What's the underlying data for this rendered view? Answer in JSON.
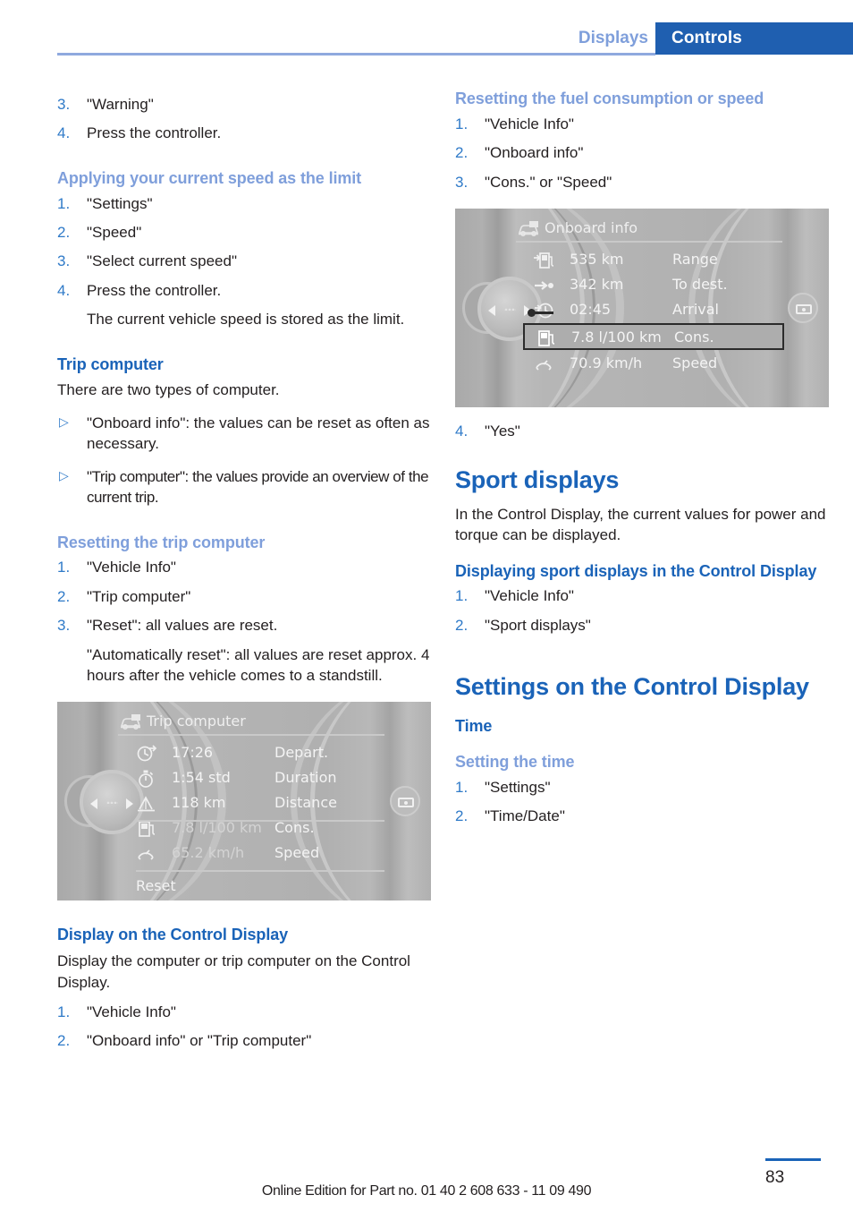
{
  "header": {
    "tab_inactive": "Displays",
    "tab_active": "Controls"
  },
  "left_column": {
    "steps_top": [
      {
        "num": "3.",
        "text": "\"Warning\""
      },
      {
        "num": "4.",
        "text": "Press the controller."
      }
    ],
    "heading_apply_speed": "Applying your current speed as the limit",
    "steps_apply_speed": [
      {
        "num": "1.",
        "text": "\"Settings\""
      },
      {
        "num": "2.",
        "text": "\"Speed\""
      },
      {
        "num": "3.",
        "text": "\"Select current speed\""
      },
      {
        "num": "4.",
        "text": "Press the controller."
      }
    ],
    "apply_speed_note": "The current vehicle speed is stored as the limit.",
    "heading_trip_computer": "Trip computer",
    "trip_intro": "There are two types of computer.",
    "trip_bullets": [
      "\"Onboard info\": the values can be reset as often as necessary.",
      "\"Trip computer\": the values provide an overview of the current trip."
    ],
    "heading_resetting": "Resetting the trip computer",
    "steps_resetting": [
      {
        "num": "1.",
        "text": "\"Vehicle Info\""
      },
      {
        "num": "2.",
        "text": "\"Trip computer\""
      },
      {
        "num": "3.",
        "text": "\"Reset\": all values are reset."
      }
    ],
    "resetting_note": "\"Automatically reset\": all values are reset approx. 4 hours after the vehicle comes to a standstill.",
    "heading_display_control": "Display on the Control Display",
    "display_control_intro": "Display the computer or trip computer on the Control Display.",
    "steps_display_control": [
      {
        "num": "1.",
        "text": "\"Vehicle Info\""
      },
      {
        "num": "2.",
        "text": "\"Onboard info\" or \"Trip computer\""
      }
    ]
  },
  "right_column": {
    "heading_resetting_fuel": "Resetting the fuel consumption or speed",
    "steps_resetting_fuel": [
      {
        "num": "1.",
        "text": "\"Vehicle Info\""
      },
      {
        "num": "2.",
        "text": "\"Onboard info\""
      },
      {
        "num": "3.",
        "text": "\"Cons.\" or \"Speed\""
      }
    ],
    "step_after_image": {
      "num": "4.",
      "text": "\"Yes\""
    },
    "heading_sport_displays": "Sport displays",
    "sport_intro": "In the Control Display, the current values for power and torque can be displayed.",
    "heading_displaying_sport": "Displaying sport displays in the Control Display",
    "steps_displaying_sport": [
      {
        "num": "1.",
        "text": "\"Vehicle Info\""
      },
      {
        "num": "2.",
        "text": "\"Sport displays\""
      }
    ],
    "heading_settings_control": "Settings on the Control Display",
    "heading_time": "Time",
    "heading_setting_time": "Setting the time",
    "steps_setting_time": [
      {
        "num": "1.",
        "text": "\"Settings\""
      },
      {
        "num": "2.",
        "text": "\"Time/Date\""
      }
    ]
  },
  "trip_computer_display": {
    "title": "Trip computer",
    "rows": [
      {
        "icon": "departure-clock-icon",
        "value": "17:26",
        "label": "Depart."
      },
      {
        "icon": "stopwatch-icon",
        "value": "1:54 std",
        "label": "Duration"
      },
      {
        "icon": "distance-icon",
        "value": "118 km",
        "label": "Distance"
      },
      {
        "icon": "fuel-pump-icon",
        "value": "7.8 l/100 km",
        "label": "Cons."
      },
      {
        "icon": "speedometer-icon",
        "value": "65.2 km/h",
        "label": "Speed"
      }
    ],
    "reset_label": "Reset"
  },
  "onboard_info_display": {
    "title": "Onboard info",
    "rows": [
      {
        "icon": "range-fuel-icon",
        "value": "535 km",
        "label": "Range"
      },
      {
        "icon": "destination-arrow-icon",
        "value": "342 km",
        "label": "To dest."
      },
      {
        "icon": "arrival-clock-icon",
        "value": "02:45",
        "label": "Arrival"
      },
      {
        "icon": "fuel-pump-icon",
        "value": "7.8 l/100 km",
        "label": "Cons."
      },
      {
        "icon": "speedometer-icon",
        "value": "70.9 km/h",
        "label": "Speed"
      }
    ],
    "selected_row_index": 3
  },
  "footer": {
    "edition_text": "Online Edition for Part no. 01 40 2 608 633 - 11 09 490",
    "page_number": "83"
  },
  "colors": {
    "brand_blue": "#1a63b8",
    "light_blue": "#7f9fdb",
    "tab_blue": "#1f5fb0",
    "number_blue": "#2f7ac8"
  }
}
